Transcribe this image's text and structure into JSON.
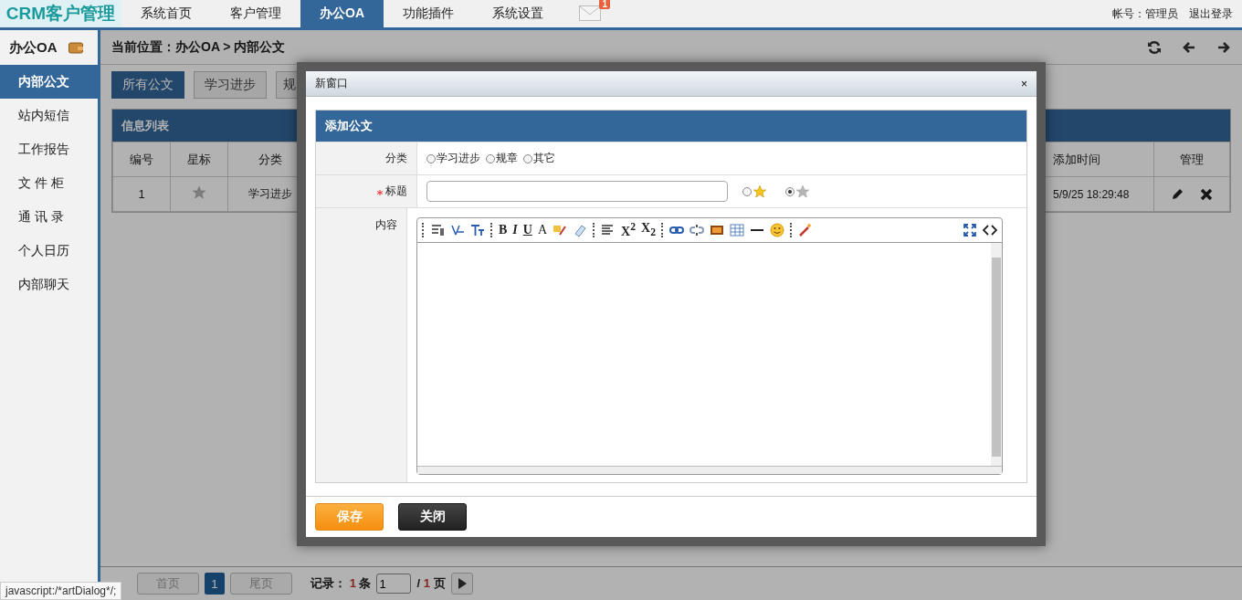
{
  "app": {
    "logo": "CRM客户管理"
  },
  "nav": [
    {
      "label": "系统首页",
      "selected": false
    },
    {
      "label": "客户管理",
      "selected": false
    },
    {
      "label": "办公OA",
      "selected": true
    },
    {
      "label": "功能插件",
      "selected": false
    },
    {
      "label": "系统设置",
      "selected": false
    }
  ],
  "mail_badge": "1",
  "account": {
    "label": "帐号：",
    "user": "管理员",
    "logout": "退出登录"
  },
  "sidebar": {
    "title": "办公OA",
    "items": [
      {
        "label": "内部公文",
        "selected": true
      },
      {
        "label": "站内短信",
        "selected": false
      },
      {
        "label": "工作报告",
        "selected": false
      },
      {
        "label": "文 件 柜",
        "selected": false
      },
      {
        "label": "通 讯 录",
        "selected": false
      },
      {
        "label": "个人日历",
        "selected": false
      },
      {
        "label": "内部聊天",
        "selected": false
      }
    ]
  },
  "breadcrumb": "当前位置：办公OA > 内部公文",
  "filters": [
    {
      "label": "所有公文",
      "selected": true
    },
    {
      "label": "学习进步",
      "selected": false
    },
    {
      "label": "规",
      "selected": false
    }
  ],
  "table": {
    "title": "信息列表",
    "columns": [
      "编号",
      "星标",
      "分类",
      "添加时间",
      "管理"
    ],
    "rows": [
      {
        "id": "1",
        "starred": false,
        "category": "学习进步",
        "time": "5/9/25 18:29:48"
      }
    ]
  },
  "pagination": {
    "first": "首页",
    "page": "1",
    "last": "尾页",
    "records_label": "记录：",
    "records": "1",
    "records_unit": "条",
    "page_input": "1",
    "total_prefix": "/",
    "total": "1",
    "total_unit": "页"
  },
  "status_link": "javascript:/*artDialog*/;",
  "dialog": {
    "title": "新窗口",
    "close": "×",
    "form_title": "添加公文",
    "category": {
      "label": "分类",
      "options": [
        {
          "label": "学习进步",
          "selected": false
        },
        {
          "label": "规章",
          "selected": false
        },
        {
          "label": "其它",
          "selected": false
        }
      ]
    },
    "title_field": {
      "label": "标题",
      "required": true,
      "importance": [
        {
          "important": true,
          "selected": false
        },
        {
          "important": false,
          "selected": true
        }
      ]
    },
    "content": {
      "label": "内容",
      "toolbar_texts": [
        "B",
        "I",
        "U",
        "A",
        "X$^{2}$",
        "X$_{2}$"
      ]
    },
    "buttons": [
      {
        "label": "保存",
        "kind": "primary"
      },
      {
        "label": "关闭",
        "kind": "dark"
      }
    ]
  }
}
